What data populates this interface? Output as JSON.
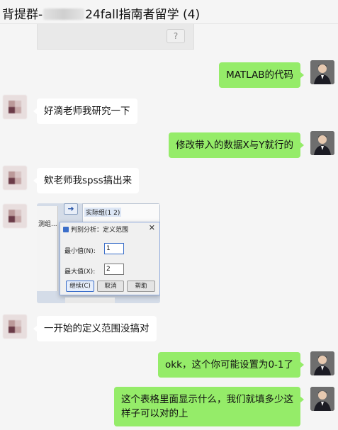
{
  "header": {
    "title_prefix": "背提群-",
    "title_suffix": "24fall指南者留学 (4)"
  },
  "previous_card": {
    "button_label": "?"
  },
  "messages": [
    {
      "id": "m1",
      "sender": "me",
      "text": "MATLAB的代码"
    },
    {
      "id": "m2",
      "sender": "other",
      "text": "好滴老师我研究一下"
    },
    {
      "id": "m3",
      "sender": "me",
      "text": "修改带入的数据X与Y就行的"
    },
    {
      "id": "m4",
      "sender": "other",
      "text": "欸老师我spss搞出来"
    },
    {
      "id": "m5",
      "sender": "other",
      "type": "image"
    },
    {
      "id": "m6",
      "sender": "other",
      "text": "一开始的定义范围没搞对"
    },
    {
      "id": "m7",
      "sender": "me",
      "text": "okk，这个你可能设置为0-1了"
    },
    {
      "id": "m8",
      "sender": "me",
      "lines": [
        "这个表格里面显示什么，我们就填多少这",
        "样子可以对的上"
      ]
    }
  ],
  "screenshot": {
    "left_panel_text": "测组...",
    "arrow_glyph": "➜",
    "list_item": "实际组(1 2)",
    "dialog_title": "判别分析：定义范围",
    "close_glyph": "✕",
    "min_label": "最小值(N):",
    "min_value": "1",
    "max_label": "最大值(X):",
    "max_value": "2",
    "btn_continue": "继续(C)",
    "btn_cancel": "取消",
    "btn_help": "帮助"
  },
  "colors": {
    "my_bubble": "#95ec69",
    "other_bubble": "#ffffff",
    "background": "#f5f5f5"
  }
}
